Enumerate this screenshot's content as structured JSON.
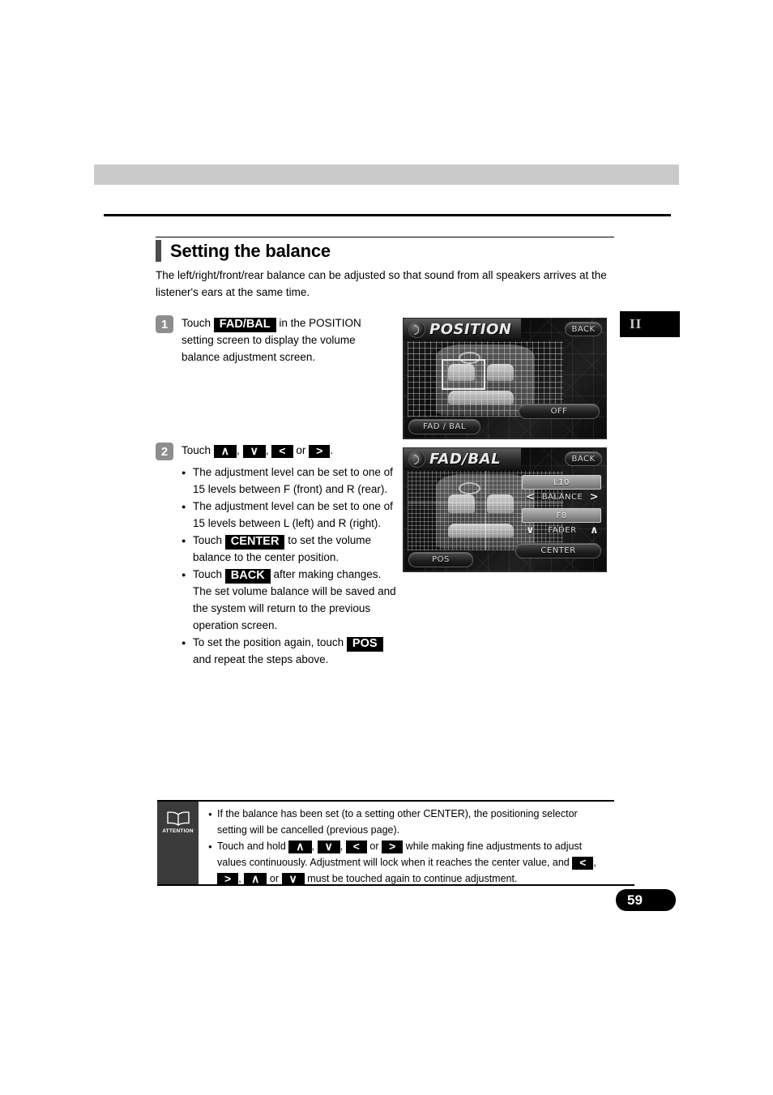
{
  "page": {
    "number": "59",
    "chapter_marker": "II"
  },
  "section": {
    "title": "Setting the balance",
    "intro": "The left/right/front/rear balance can be adjusted so that sound from all speakers arrives at the listener's ears at the same time."
  },
  "steps": [
    {
      "badge": "1",
      "text_before": "Touch",
      "chip": "FAD/BAL",
      "text_after": "in the POSITION setting screen to display the volume balance adjustment screen."
    },
    {
      "badge": "2",
      "lead_before": "Touch",
      "chip_up": "∧",
      "chip_down": "∨",
      "chip_left": "<",
      "chip_right": ">",
      "lead_or": "or",
      "lead_end": ".",
      "bullets": [
        {
          "text": "The adjustment level can be set to one of 15 levels between F (front) and R (rear)."
        },
        {
          "text": "The adjustment level can be set to one of 15 levels between L (left) and R (right)."
        },
        {
          "pre": "Touch",
          "chip": "CENTER",
          "post": "to set the volume balance to the center position."
        },
        {
          "pre": "Touch",
          "chip": "BACK",
          "post": "after making changes. The set volume balance will be saved and the system will return to the previous operation screen."
        },
        {
          "pre": "To set the position again, touch",
          "chip": "POS",
          "post": "and repeat the steps above."
        }
      ]
    }
  ],
  "device_position": {
    "title": "POSITION",
    "back": "BACK",
    "off": "OFF",
    "fadbal": "FAD / BAL"
  },
  "device_fadbal": {
    "title": "FAD/BAL",
    "back": "BACK",
    "pos": "POS",
    "balance_value": "L10",
    "balance_label": "BALANCE",
    "balance_left_arrow": "<",
    "balance_right_arrow": ">",
    "fader_value": "F8",
    "fader_label": "FADER",
    "fader_down_arrow": "∨",
    "fader_up_arrow": "∧",
    "center": "CENTER"
  },
  "attention": {
    "icon_label": "ATTENTION",
    "items": [
      {
        "text": "If the balance has been set (to a setting other CENTER), the positioning selector setting will be cancelled (previous page)."
      },
      {
        "pre": "Touch and hold",
        "chip_up": "∧",
        "chip_down": "∨",
        "chip_left": "<",
        "chip_right": ">",
        "or": "or",
        "mid": "while making fine adjustments to adjust values continuously. Adjustment will lock when it reaches the center value, and",
        "chip_left2": "<",
        "chip_right2": ">",
        "chip_up2": "∧",
        "chip_down2": "∨",
        "or2": "or",
        "post": "must be touched again to continue adjustment."
      }
    ]
  }
}
